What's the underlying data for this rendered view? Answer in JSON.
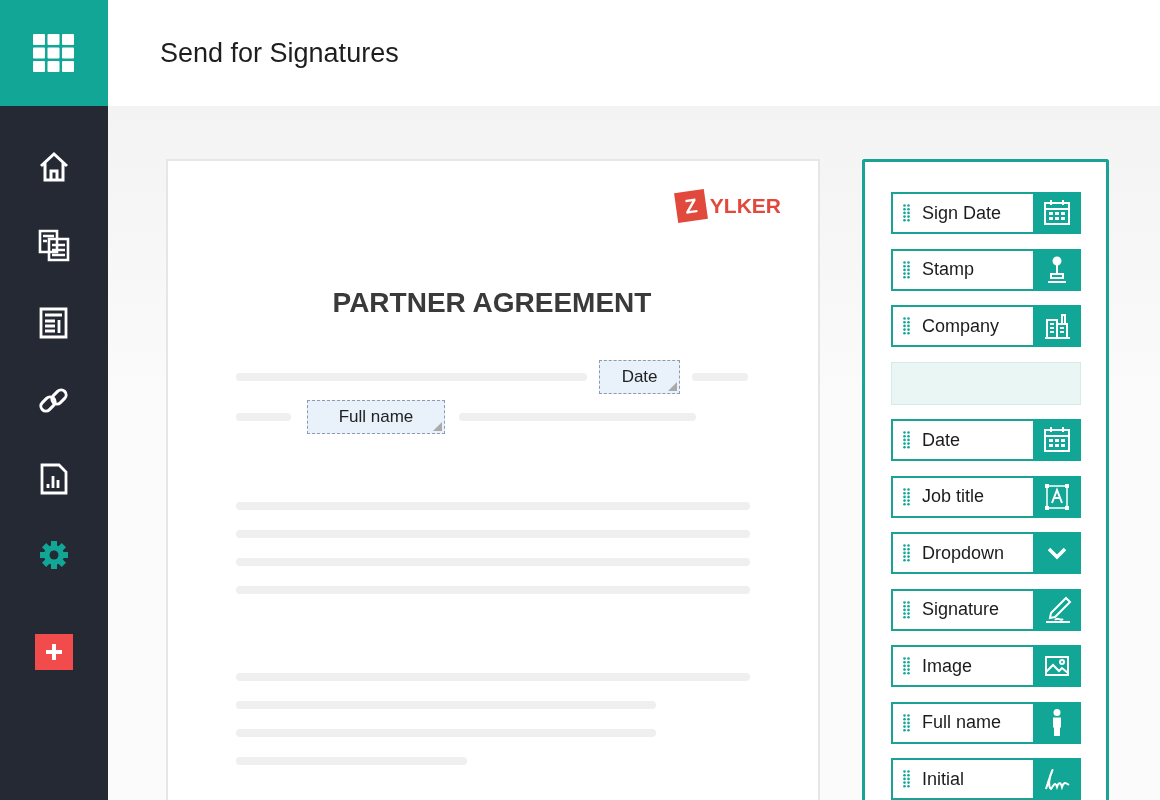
{
  "header": {
    "title": "Send for Signatures"
  },
  "sidebar": {
    "items": [
      {
        "selected": false
      },
      {
        "selected": false
      },
      {
        "selected": false
      },
      {
        "selected": false
      },
      {
        "selected": false
      },
      {
        "selected": true
      }
    ]
  },
  "document": {
    "logo": {
      "mark": "Z",
      "text": "YLKER"
    },
    "title": "PARTNER AGREEMENT",
    "placed_fields": [
      {
        "label": "Date"
      },
      {
        "label": "Full name"
      }
    ]
  },
  "field_panel": {
    "fields": [
      {
        "kind": "field",
        "label": "Sign Date"
      },
      {
        "kind": "field",
        "label": "Stamp"
      },
      {
        "kind": "field",
        "label": "Company"
      },
      {
        "kind": "slot"
      },
      {
        "kind": "field",
        "label": "Date"
      },
      {
        "kind": "field",
        "label": "Job title"
      },
      {
        "kind": "field",
        "label": "Dropdown"
      },
      {
        "kind": "field",
        "label": "Signature"
      },
      {
        "kind": "field",
        "label": "Image"
      },
      {
        "kind": "field",
        "label": "Full name"
      },
      {
        "kind": "field",
        "label": "Initial"
      }
    ]
  }
}
